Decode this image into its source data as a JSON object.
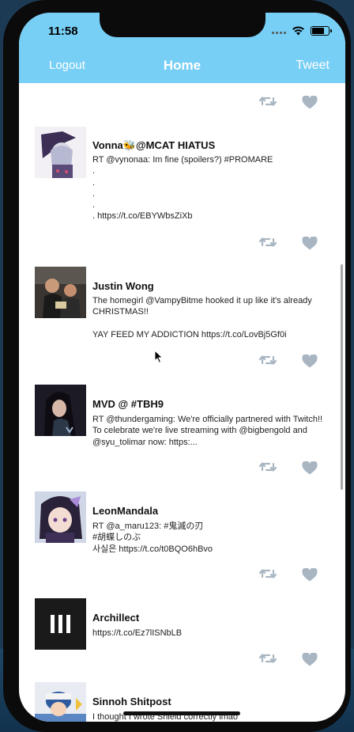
{
  "status": {
    "time": "11:58"
  },
  "navbar": {
    "logout": "Logout",
    "title": "Home",
    "tweet": "Tweet"
  },
  "colors": {
    "nav": "#78cff6",
    "action_icon": "#a9b6c2"
  },
  "tweets": [
    {
      "name": "Vonna🐝@MCAT HIATUS",
      "text": "RT @vynonaa: Im fine (spoilers?) #PROMARE\n.\n.\n.\n.\n. https://t.co/EBYWbsZiXb"
    },
    {
      "name": "Justin Wong",
      "text": "The homegirl @VampyBitme hooked it up like it's already CHRISTMAS!!\n\nYAY FEED MY ADDICTION https://t.co/LovBj5Gf0i"
    },
    {
      "name": "MVD @ #TBH9",
      "text": "RT @thundergaming: We're officially partnered with Twitch!! To celebrate we're live streaming with @bigbengold and @syu_tolimar now: https:..."
    },
    {
      "name": "LeonMandala",
      "text": "RT @a_maru123: #鬼滅の刃\n#胡蝶しのぶ\n사실은 https://t.co/t0BQO6hBvo"
    },
    {
      "name": "Archillect",
      "text": "https://t.co/Ez7lISNbLB"
    },
    {
      "name": "Sinnoh Shitpost",
      "text": "I thought I wrote Shield correctly lmao"
    }
  ]
}
